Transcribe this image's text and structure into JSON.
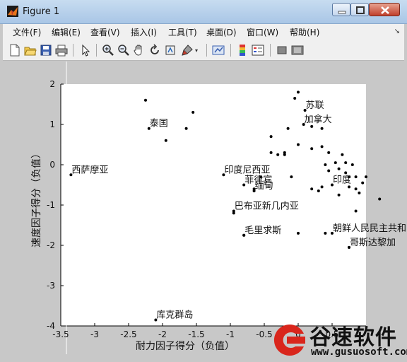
{
  "window": {
    "title": "Figure 1"
  },
  "menu": {
    "items": [
      "文件(F)",
      "编辑(E)",
      "查看(V)",
      "插入(I)",
      "工具(T)",
      "桌面(D)",
      "窗口(W)",
      "帮助(H)"
    ]
  },
  "toolbar": {
    "icons": [
      "new-figure-icon",
      "open-file-icon",
      "save-icon",
      "print-icon",
      "pointer-icon",
      "zoom-in-icon",
      "zoom-out-icon",
      "pan-icon",
      "rotate-3d-icon",
      "data-cursor-icon",
      "brush-icon",
      "link-plot-icon",
      "colorbar-icon",
      "legend-icon",
      "hide-plot-tools-icon",
      "show-plot-tools-icon"
    ]
  },
  "chart_data": {
    "type": "scatter",
    "xlabel": "耐力因子得分（负值）",
    "ylabel": "速度因子得分（负值）",
    "xlim": [
      -3.5,
      1
    ],
    "ylim": [
      -4,
      2
    ],
    "xticks": [
      "-3.5",
      "-3",
      "-2.5",
      "-2",
      "-1.5",
      "-1",
      "-0.5",
      "0",
      "0.5"
    ],
    "yticks": [
      "2",
      "1",
      "0",
      "-1",
      "-2",
      "-3",
      "-4"
    ],
    "grid": false,
    "labeled_points": [
      {
        "label": "苏联",
        "x": 0.1,
        "y": 1.35
      },
      {
        "label": "加拿大",
        "x": 0.08,
        "y": 1.0
      },
      {
        "label": "泰国",
        "x": -2.2,
        "y": 0.9
      },
      {
        "label": "西萨摩亚",
        "x": -3.35,
        "y": -0.25
      },
      {
        "label": "印度尼西亚",
        "x": -1.1,
        "y": -0.25
      },
      {
        "label": "菲律宾",
        "x": -0.8,
        "y": -0.5
      },
      {
        "label": "缅甸",
        "x": -0.65,
        "y": -0.65
      },
      {
        "label": "印度",
        "x": 0.5,
        "y": -0.5
      },
      {
        "label": "巴布亚新几内亚",
        "x": -0.95,
        "y": -1.15
      },
      {
        "label": "毛里求斯",
        "x": -0.8,
        "y": -1.75
      },
      {
        "label": "朝鲜人民民主共和国",
        "x": 0.5,
        "y": -1.7
      },
      {
        "label": "哥斯达黎加",
        "x": 0.75,
        "y": -2.05
      },
      {
        "label": "库克群岛",
        "x": -2.1,
        "y": -3.85
      }
    ],
    "points": [
      {
        "x": -2.25,
        "y": 1.6
      },
      {
        "x": -1.55,
        "y": 1.3
      },
      {
        "x": -1.65,
        "y": 0.9
      },
      {
        "x": -1.95,
        "y": 0.6
      },
      {
        "x": 0.0,
        "y": 1.8
      },
      {
        "x": -0.05,
        "y": 1.65
      },
      {
        "x": -0.4,
        "y": 0.7
      },
      {
        "x": -0.15,
        "y": 0.9
      },
      {
        "x": -0.4,
        "y": 0.3
      },
      {
        "x": -0.3,
        "y": 0.25
      },
      {
        "x": -0.2,
        "y": 0.3
      },
      {
        "x": -0.2,
        "y": 0.25
      },
      {
        "x": 0.0,
        "y": 0.5
      },
      {
        "x": 0.2,
        "y": 0.4
      },
      {
        "x": 0.35,
        "y": 0.45
      },
      {
        "x": 0.45,
        "y": 0.3
      },
      {
        "x": 0.2,
        "y": 0.95
      },
      {
        "x": 0.35,
        "y": 0.9
      },
      {
        "x": 0.4,
        "y": 0.0
      },
      {
        "x": 0.45,
        "y": -0.15
      },
      {
        "x": 0.55,
        "y": 0.05
      },
      {
        "x": 0.6,
        "y": -0.1
      },
      {
        "x": 0.65,
        "y": 0.25
      },
      {
        "x": 0.7,
        "y": 0.05
      },
      {
        "x": 0.7,
        "y": -0.2
      },
      {
        "x": 0.75,
        "y": -0.3
      },
      {
        "x": 0.8,
        "y": 0.0
      },
      {
        "x": 0.85,
        "y": -0.3
      },
      {
        "x": 0.85,
        "y": -0.6
      },
      {
        "x": 0.9,
        "y": -0.7
      },
      {
        "x": 0.95,
        "y": -0.45
      },
      {
        "x": 1.0,
        "y": -0.3
      },
      {
        "x": 0.6,
        "y": -0.75
      },
      {
        "x": 0.75,
        "y": -0.55
      },
      {
        "x": 1.2,
        "y": -0.85
      },
      {
        "x": -0.1,
        "y": -0.3
      },
      {
        "x": 0.2,
        "y": -0.6
      },
      {
        "x": 0.35,
        "y": -0.55
      },
      {
        "x": 0.3,
        "y": -0.65
      },
      {
        "x": 0.85,
        "y": -1.15
      },
      {
        "x": -0.95,
        "y": -1.2
      },
      {
        "x": 0.0,
        "y": -1.7
      },
      {
        "x": -0.8,
        "y": -1.75
      },
      {
        "x": 0.4,
        "y": -1.7
      },
      {
        "x": 0.75,
        "y": -2.05
      },
      {
        "x": -0.55,
        "y": -0.3
      },
      {
        "x": -0.65,
        "y": -0.6
      }
    ]
  },
  "watermark": {
    "brand": "谷速软件",
    "url": "www.gusuosoft.com"
  }
}
